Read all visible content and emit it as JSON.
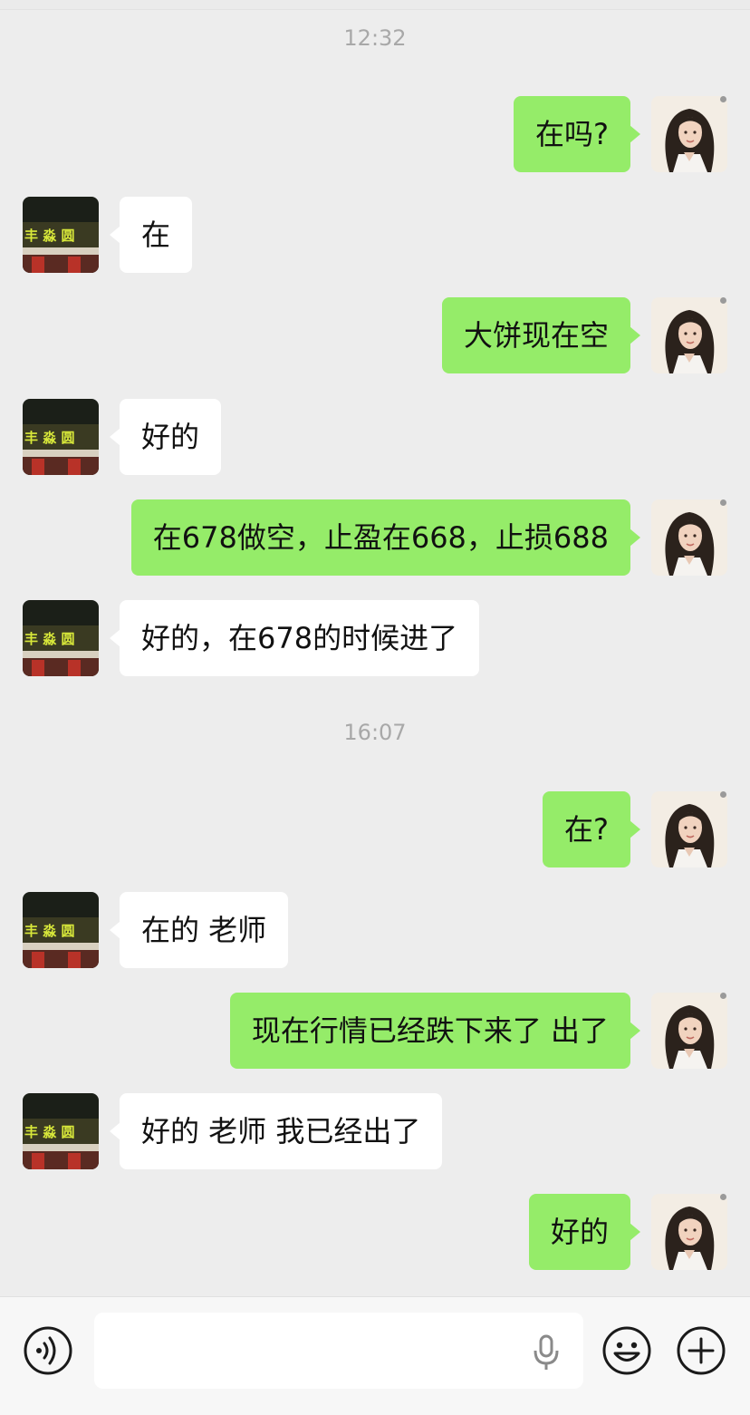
{
  "timestamps": [
    "12:32",
    "16:07"
  ],
  "messages": [
    {
      "side": "right",
      "text": "在吗?"
    },
    {
      "side": "left",
      "text": "在"
    },
    {
      "side": "right",
      "text": "大饼现在空"
    },
    {
      "side": "left",
      "text": "好的"
    },
    {
      "side": "right",
      "text": "在678做空，止盈在668，止损688"
    },
    {
      "side": "left",
      "text": "好的，在678的时候进了"
    },
    {
      "side": "right",
      "text": "在?"
    },
    {
      "side": "left",
      "text": "在的 老师"
    },
    {
      "side": "right",
      "text": "现在行情已经跌下来了 出了"
    },
    {
      "side": "left",
      "text": "好的 老师 我已经出了"
    },
    {
      "side": "right",
      "text": "好的"
    }
  ],
  "avatars": {
    "contact": "storefront-photo-avatar",
    "self": "woman-illustration-avatar",
    "contact_sign_text": "丰 淼 圆"
  },
  "input_bar": {
    "placeholder": "",
    "icons": [
      "voice-mode-icon",
      "microphone-icon",
      "emoji-icon",
      "plus-icon"
    ]
  },
  "colors": {
    "background": "#ededed",
    "sent_bubble": "#95ec69",
    "received_bubble": "#ffffff",
    "timestamp": "#a8a8a8"
  }
}
